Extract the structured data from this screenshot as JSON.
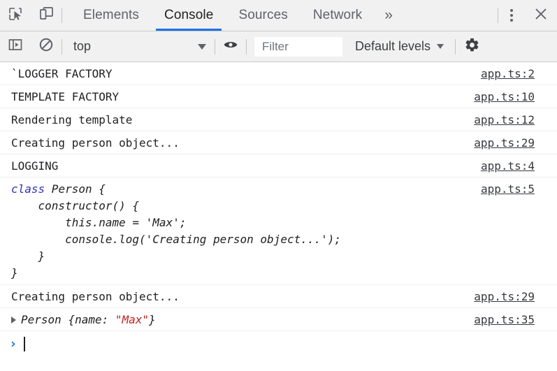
{
  "tabbar": {
    "inspect_icon": "inspect-cursor-icon",
    "device_icon": "device-toolbar-icon",
    "tabs": [
      {
        "label": "Elements",
        "active": false
      },
      {
        "label": "Console",
        "active": true
      },
      {
        "label": "Sources",
        "active": false
      },
      {
        "label": "Network",
        "active": false
      }
    ],
    "more_tabs_label": "»",
    "kebab_icon": "more-options-icon",
    "close_icon": "close-icon",
    "active_underline_color": "#1a73e8"
  },
  "console_toolbar": {
    "sidebar_toggle_icon": "console-sidebar-toggle-icon",
    "clear_icon": "clear-console-icon",
    "context_value": "top",
    "eye_icon": "live-expression-eye-icon",
    "filter_placeholder": "Filter",
    "filter_value": "",
    "levels_label": "Default levels",
    "gear_icon": "settings-gear-icon"
  },
  "log": {
    "entries": [
      {
        "type": "text",
        "message": "`LOGGER FACTORY",
        "source": "app.ts:2"
      },
      {
        "type": "text",
        "message": "TEMPLATE FACTORY",
        "source": "app.ts:10"
      },
      {
        "type": "text",
        "message": "Rendering template",
        "source": "app.ts:12"
      },
      {
        "type": "text",
        "message": "Creating person object...",
        "source": "app.ts:29"
      },
      {
        "type": "text",
        "message": "LOGGING",
        "source": "app.ts:4"
      },
      {
        "type": "code",
        "keyword": "class",
        "code_rest": " Person {\n    constructor() {\n        this.name = 'Max';\n        console.log('Creating person object...');\n    }\n}",
        "source": "app.ts:5"
      },
      {
        "type": "text",
        "message": "Creating person object...",
        "source": "app.ts:29"
      },
      {
        "type": "object",
        "object_name": "Person ",
        "object_open": "{name: ",
        "object_value": "\"Max\"",
        "object_close": "}",
        "source": "app.ts:35"
      }
    ]
  },
  "prompt": {
    "chevron": "›",
    "value": ""
  },
  "colors": {
    "accent": "#1a73e8",
    "keyword": "#2f31b5",
    "string": "#c5221f",
    "text": "#202124",
    "toolbar_bg": "#f1f1f1"
  }
}
